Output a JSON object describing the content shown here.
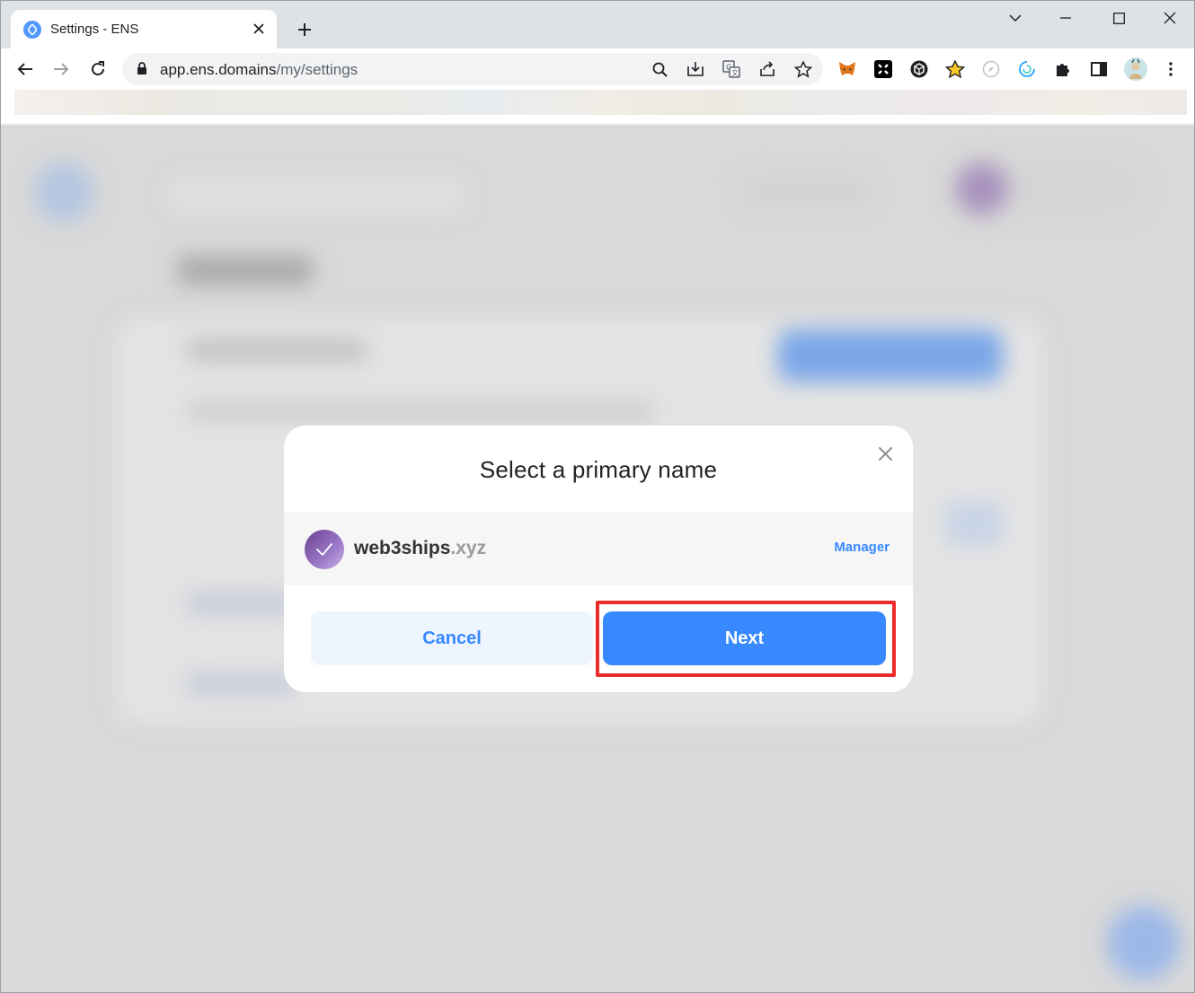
{
  "browser": {
    "tab": {
      "title": "Settings - ENS"
    },
    "url": {
      "host": "app.ens.domains",
      "path": "/my/settings"
    },
    "icons": [
      "back-icon",
      "forward-icon",
      "reload-icon",
      "lock-icon",
      "zoom-icon",
      "install-icon",
      "translate-icon",
      "share-icon",
      "bookmark-star-icon",
      "metamask-icon",
      "extension-icon",
      "extension-icon",
      "star-extension-icon",
      "compass-icon",
      "swirl-icon",
      "puzzle-icon",
      "side-panel-icon",
      "profile-avatar",
      "kebab-menu-icon"
    ]
  },
  "modal": {
    "title": "Select a primary name",
    "name": {
      "label": "web3ships",
      "tld": ".xyz",
      "role": "Manager"
    },
    "cancel_label": "Cancel",
    "next_label": "Next"
  },
  "colors": {
    "accent": "#3889ff",
    "highlight": "#ee2b2b",
    "overlay": "#d9d9d9"
  }
}
